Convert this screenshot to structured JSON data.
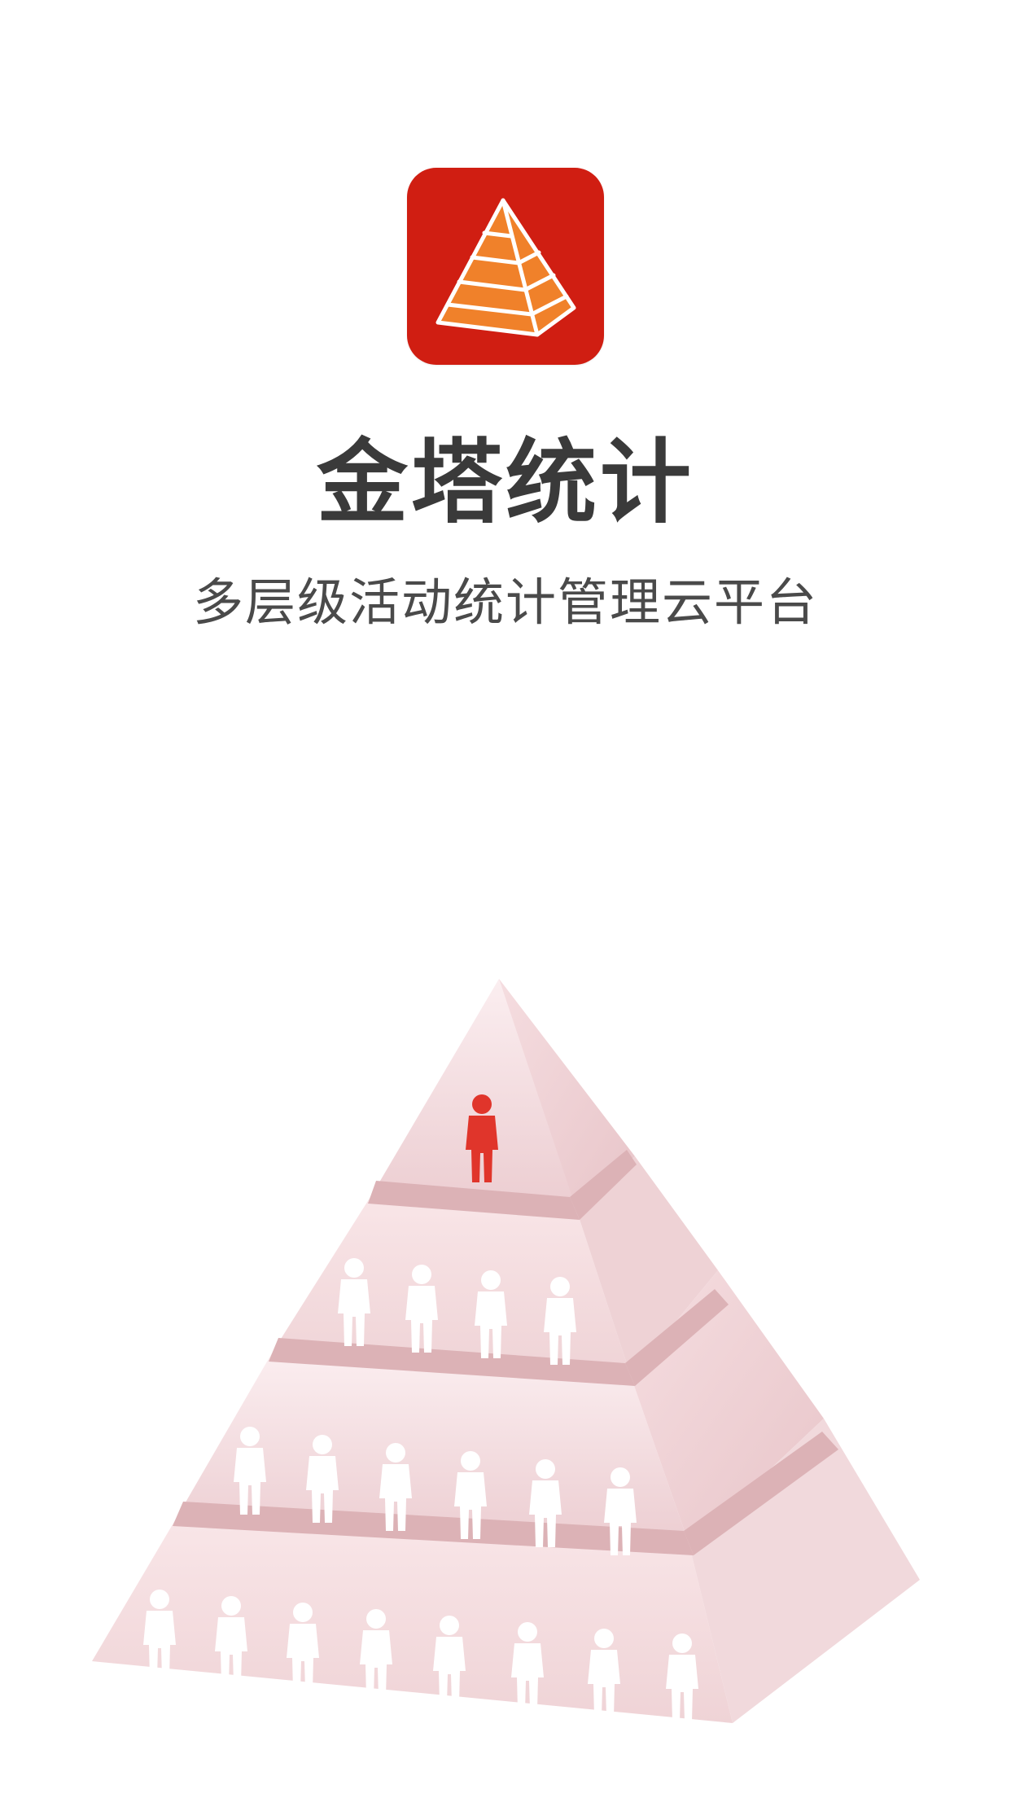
{
  "app": {
    "name": "金塔统计",
    "tagline": "多层级活动统计管理云平台"
  },
  "icons": {
    "logo": "pyramid-logo-icon",
    "leader": "person-icon",
    "member": "person-icon"
  },
  "colors": {
    "icon_background": "#d01e12",
    "icon_pyramid": "#f0812a",
    "pyramid_face_light": "#f8e4e6",
    "pyramid_face_mid": "#efcfd2",
    "pyramid_ledge": "#dcb2b6",
    "leader_figure": "#e0352b",
    "member_figure": "#ffffff",
    "title_text": "#3a3a3a",
    "tagline_text": "#4a4a4a"
  }
}
